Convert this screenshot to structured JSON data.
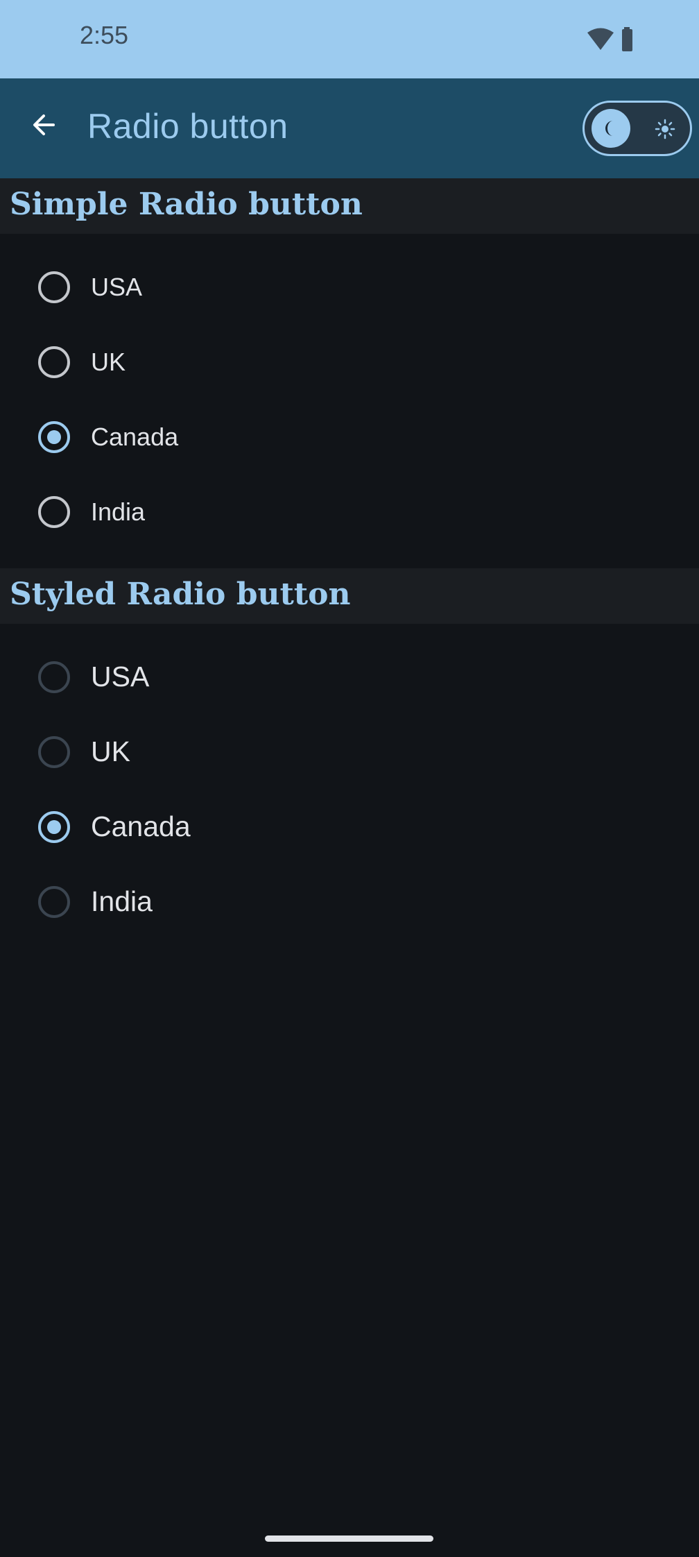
{
  "status_bar": {
    "time": "2:55",
    "wifi_icon": "wifi-icon",
    "battery_icon": "battery-icon"
  },
  "app_bar": {
    "back_icon": "arrow-back-icon",
    "title": "Radio button",
    "theme_toggle": {
      "mode": "dark",
      "knob_icon": "moon-icon",
      "alt_icon": "sun-icon"
    }
  },
  "sections": [
    {
      "title": "Simple Radio button",
      "options": [
        "USA",
        "UK",
        "Canada",
        "India"
      ],
      "selected": "Canada"
    },
    {
      "title": "Styled Radio button",
      "options": [
        "USA",
        "UK",
        "Canada",
        "India"
      ],
      "selected": "Canada"
    }
  ],
  "colors": {
    "accent": "#9ccbef",
    "app_bar": "#1d4c66",
    "background": "#111418",
    "section_header_bg": "#1b1e22",
    "text": "#e2e4e8"
  }
}
